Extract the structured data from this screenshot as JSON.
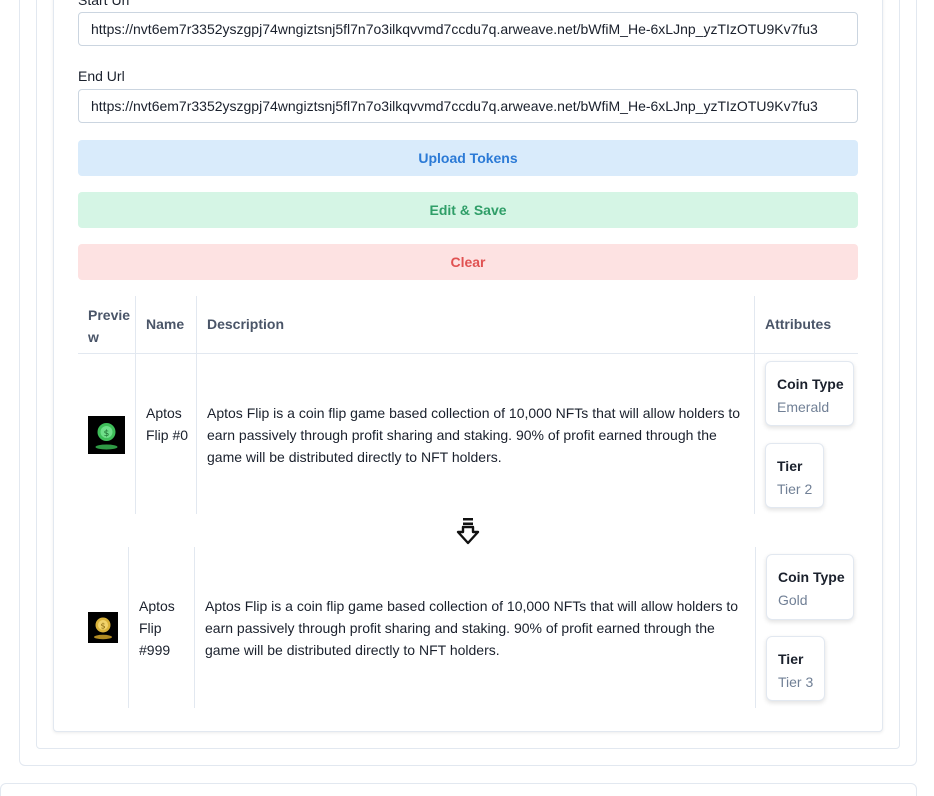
{
  "form": {
    "start_url_label": "Start Url",
    "start_url_value": "https://nvt6em7r3352yszgpj74wngiztsnj5fl7n7o3ilkqvvmd7ccdu7q.arweave.net/bWfiM_He-6xLJnp_yzTIzOTU9Kv7fu3",
    "end_url_label": "End Url",
    "end_url_value": "https://nvt6em7r3352yszgpj74wngiztsnj5fl7n7o3ilkqvvmd7ccdu7q.arweave.net/bWfiM_He-6xLJnp_yzTIzOTU9Kv7fu3"
  },
  "buttons": {
    "upload": "Upload Tokens",
    "save": "Edit & Save",
    "clear": "Clear"
  },
  "table": {
    "headers": {
      "preview": "Preview",
      "name": "Name",
      "description": "Description",
      "attributes": "Attributes"
    },
    "rows": [
      {
        "name": "Aptos Flip #0",
        "description": "Aptos Flip is a coin flip game based collection of 10,000 NFTs that will allow holders to earn passively through profit sharing and staking. 90% of profit earned through the game will be distributed directly to NFT holders.",
        "coin_color": "#3fbf5a",
        "attributes": [
          {
            "trait": "Coin Type",
            "value": "Emerald"
          },
          {
            "trait": "Tier",
            "value": "Tier 2"
          }
        ]
      },
      {
        "name": "Aptos Flip #999",
        "description": "Aptos Flip is a coin flip game based collection of 10,000 NFTs that will allow holders to earn passively through profit sharing and staking. 90% of profit earned through the game will be distributed directly to NFT holders.",
        "coin_color": "#d9b23a",
        "attributes": [
          {
            "trait": "Coin Type",
            "value": "Gold"
          },
          {
            "trait": "Tier",
            "value": "Tier 3"
          }
        ]
      }
    ]
  },
  "icons": {
    "range_arrow": "double-arrow-down-icon"
  },
  "colors": {
    "upload_bg": "#d9ebfb",
    "upload_text": "#2b7ad6",
    "save_bg": "#d5f5e5",
    "save_text": "#2f9e68",
    "clear_bg": "#fde2e2",
    "clear_text": "#e05252"
  }
}
